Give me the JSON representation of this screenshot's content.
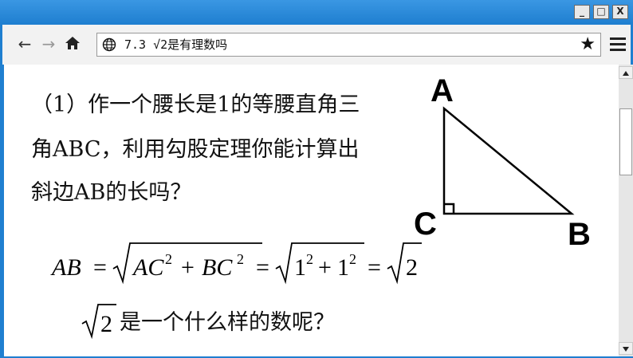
{
  "window": {
    "title_buttons": {
      "minimize": "_",
      "maximize": "□",
      "close": "X"
    }
  },
  "toolbar": {
    "back_icon": "←",
    "forward_icon": "→",
    "home_icon": "home-icon",
    "address": "7.3 √2是有理数吗",
    "bookmark_icon": "★",
    "menu_icon": "hamburger-menu-icon"
  },
  "slide": {
    "line1": "（1）作一个腰长是1的等腰直角三",
    "line2": "角ABC，利用勾股定理你能计算出",
    "line3": "斜边AB的长吗？",
    "vertex_a": "A",
    "vertex_b": "B",
    "vertex_c": "C",
    "equation": {
      "lhs": "AB",
      "eq": "=",
      "term1": "AC",
      "exp": "2",
      "plus": "+",
      "term2": "BC",
      "one": "1",
      "two": "2"
    },
    "question": "是一个什么样的数呢？",
    "question_radicand": "2"
  },
  "colors": {
    "frame": "#1f7fd0",
    "toolbar": "#f2f2f2",
    "content": "#ffffff"
  }
}
